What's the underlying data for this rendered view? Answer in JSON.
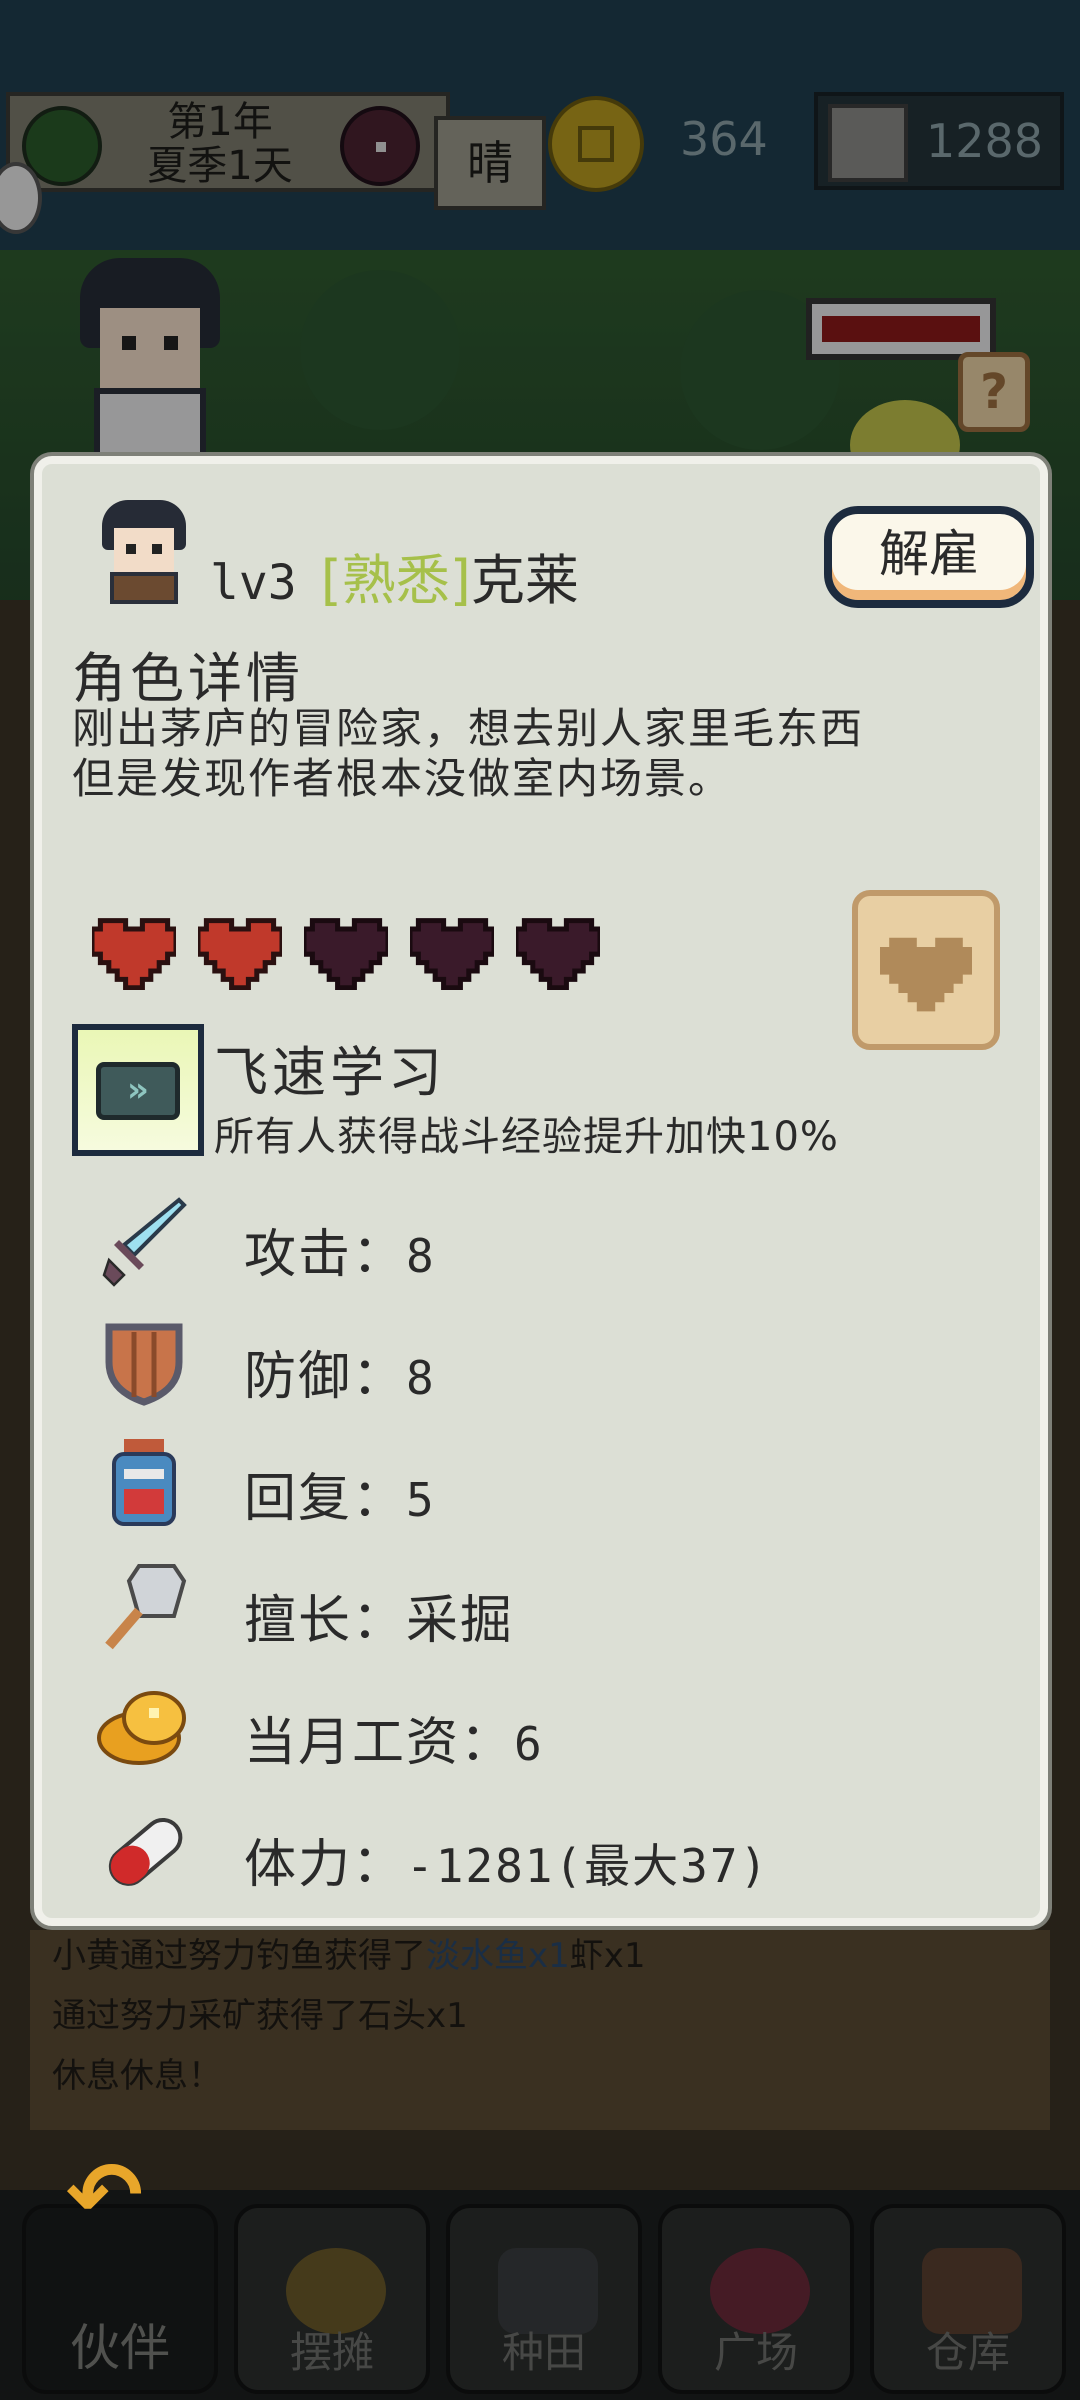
{
  "topbar": {
    "date_year": "第1年",
    "date_day": "夏季1天",
    "weather": "晴",
    "coins": "364",
    "stones": "1288"
  },
  "dialog": {
    "level": "lv3",
    "familiarity": "[熟悉]",
    "name": "克莱",
    "fire_button": "解雇",
    "section_title": "角色详情",
    "description_line1": "刚出茅庐的冒险家，想去别人家里毛东西",
    "description_line2": "但是发现作者根本没做室内场景。",
    "hearts": {
      "filled": 2,
      "total": 5
    },
    "skill": {
      "name": "飞速学习",
      "description": "所有人获得战斗经验提升加快10%"
    },
    "stats": {
      "attack_label": "攻击：",
      "attack_value": "8",
      "defense_label": "防御：",
      "defense_value": "8",
      "recovery_label": "回复：",
      "recovery_value": "5",
      "specialty_label": "擅长：",
      "specialty_value": "采掘",
      "salary_label": "当月工资：",
      "salary_value": "6",
      "stamina_label": "体力：",
      "stamina_value": "-1281(最大37)"
    }
  },
  "log": {
    "line1_prefix": "小黄通过努力钓鱼获得了",
    "line1_highlight": "淡水鱼x1",
    "line1_suffix": "虾x1",
    "line2": "通过努力采矿获得了石头x1",
    "line3": "休息休息！"
  },
  "nav": {
    "items": [
      "伙伴",
      "摆摊",
      "种田",
      "广场",
      "仓库"
    ]
  },
  "colors": {
    "dialog_bg": "#dcdfd5",
    "familiarity_tag": "#a6c04a",
    "heart_filled": "#c0392b",
    "heart_empty": "#3a1a2a"
  }
}
